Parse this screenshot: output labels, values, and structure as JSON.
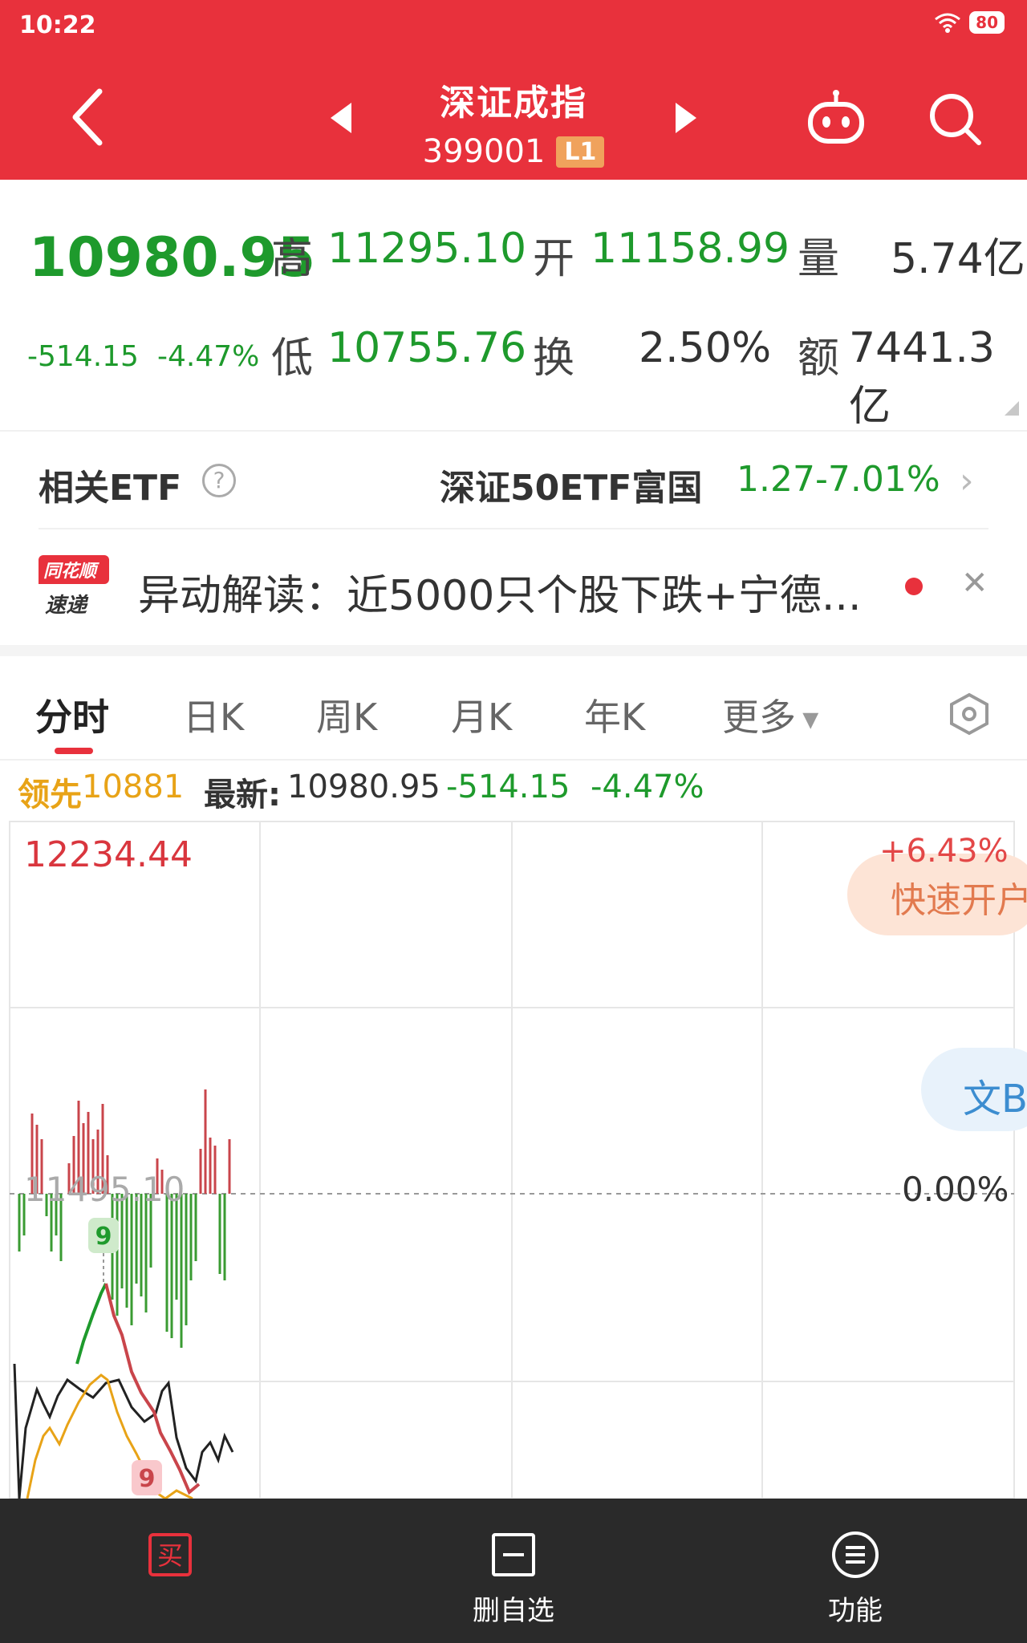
{
  "status": {
    "time": "10:22",
    "battery": "80"
  },
  "header": {
    "title": "深证成指",
    "code": "399001",
    "level_badge": "L1"
  },
  "quote": {
    "price": "10980.95",
    "change": "-514.15",
    "change_pct": "-4.47%",
    "high_label": "高",
    "high": "11295.10",
    "open_label": "开",
    "open": "11158.99",
    "volume_label": "量",
    "volume": "5.74亿",
    "low_label": "低",
    "low": "10755.76",
    "turnover_label": "换",
    "turnover": "2.50%",
    "amount_label": "额",
    "amount": "7441.3亿"
  },
  "etf": {
    "label": "相关ETF",
    "name": "深证50ETF富国",
    "price": "1.27",
    "change_pct": "-7.01%"
  },
  "news": {
    "logo_top": "同花顺",
    "logo_bottom": "速递",
    "text": "异动解读：近5000只个股下跌+宁德..."
  },
  "tabs": [
    "分时",
    "日K",
    "周K",
    "月K",
    "年K",
    "更多"
  ],
  "indicator": {
    "lead_label": "领先",
    "lead_value": "10881",
    "latest_label": "最新:",
    "latest_value": "10980.95",
    "change": "-514.15",
    "change_pct": "-4.47%"
  },
  "chart": {
    "price_top": "12234.44",
    "price_mid": "11495.10",
    "pct_top": "+6.43%",
    "pct_zero": "0.00%",
    "fast_open": "快速开户",
    "wen_label": "文B",
    "marker_label": "9"
  },
  "bottom": {
    "middle_label": "删自选",
    "right_label": "功能",
    "left_icon_char": "买"
  },
  "colors": {
    "brand_red": "#e8313c",
    "up_red": "#d9363e",
    "down_green": "#1e9a2c",
    "lead_yellow": "#e8a317"
  }
}
